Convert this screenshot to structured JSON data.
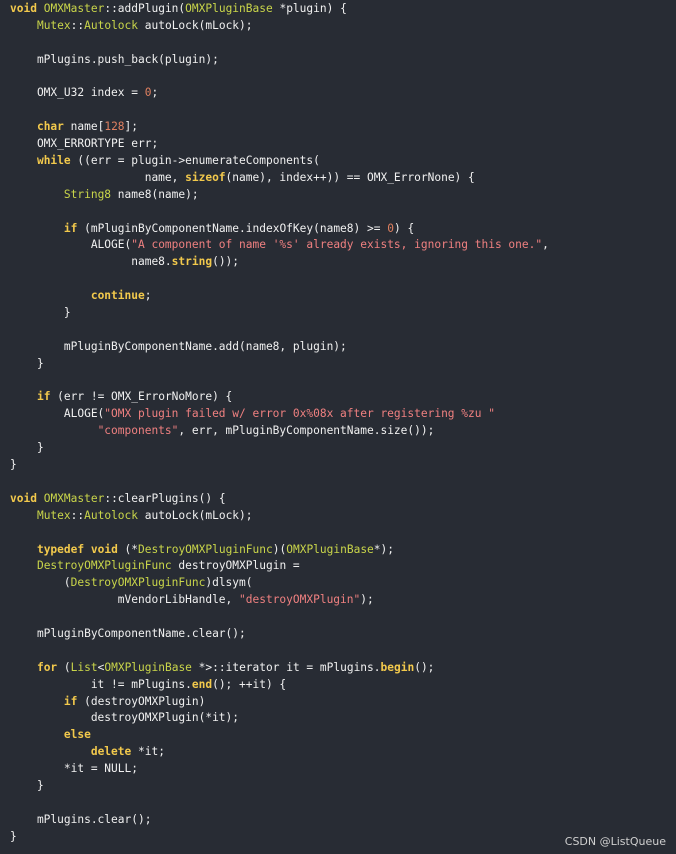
{
  "theme": {
    "background": "#282c34",
    "plain": "#f0f0f0",
    "keyword": "#f2c94c",
    "type": "#c9d54a",
    "string": "#ef8080",
    "number": "#e08060"
  },
  "code": {
    "lines": [
      [
        {
          "t": "kw",
          "v": "void"
        },
        {
          "t": "plain",
          "v": " "
        },
        {
          "t": "type",
          "v": "OMXMaster"
        },
        {
          "t": "plain",
          "v": "::addPlugin("
        },
        {
          "t": "type",
          "v": "OMXPluginBase"
        },
        {
          "t": "plain",
          "v": " *plugin) {"
        }
      ],
      [
        {
          "t": "plain",
          "v": "    "
        },
        {
          "t": "type",
          "v": "Mutex"
        },
        {
          "t": "plain",
          "v": "::"
        },
        {
          "t": "type",
          "v": "Autolock"
        },
        {
          "t": "plain",
          "v": " autoLock(mLock);"
        }
      ],
      [],
      [
        {
          "t": "plain",
          "v": "    mPlugins.push_back(plugin);"
        }
      ],
      [],
      [
        {
          "t": "plain",
          "v": "    OMX_U32 index = "
        },
        {
          "t": "num",
          "v": "0"
        },
        {
          "t": "plain",
          "v": ";"
        }
      ],
      [],
      [
        {
          "t": "plain",
          "v": "    "
        },
        {
          "t": "kw",
          "v": "char"
        },
        {
          "t": "plain",
          "v": " name["
        },
        {
          "t": "num",
          "v": "128"
        },
        {
          "t": "plain",
          "v": "];"
        }
      ],
      [
        {
          "t": "plain",
          "v": "    OMX_ERRORTYPE err;"
        }
      ],
      [
        {
          "t": "plain",
          "v": "    "
        },
        {
          "t": "kw",
          "v": "while"
        },
        {
          "t": "plain",
          "v": " ((err = plugin->enumerateComponents("
        }
      ],
      [
        {
          "t": "plain",
          "v": "                    name, "
        },
        {
          "t": "kw",
          "v": "sizeof"
        },
        {
          "t": "plain",
          "v": "(name), index++)) == OMX_ErrorNone) {"
        }
      ],
      [
        {
          "t": "plain",
          "v": "        "
        },
        {
          "t": "type",
          "v": "String8"
        },
        {
          "t": "plain",
          "v": " name8(name);"
        }
      ],
      [],
      [
        {
          "t": "plain",
          "v": "        "
        },
        {
          "t": "kw",
          "v": "if"
        },
        {
          "t": "plain",
          "v": " (mPluginByComponentName.indexOfKey(name8) >= "
        },
        {
          "t": "num",
          "v": "0"
        },
        {
          "t": "plain",
          "v": ") {"
        }
      ],
      [
        {
          "t": "plain",
          "v": "            ALOGE("
        },
        {
          "t": "str",
          "v": "\"A component of name '%s' already exists, ignoring this one.\""
        },
        {
          "t": "plain",
          "v": ","
        }
      ],
      [
        {
          "t": "plain",
          "v": "                  name8."
        },
        {
          "t": "kw",
          "v": "string"
        },
        {
          "t": "plain",
          "v": "());"
        }
      ],
      [],
      [
        {
          "t": "plain",
          "v": "            "
        },
        {
          "t": "kw",
          "v": "continue"
        },
        {
          "t": "plain",
          "v": ";"
        }
      ],
      [
        {
          "t": "plain",
          "v": "        }"
        }
      ],
      [],
      [
        {
          "t": "plain",
          "v": "        mPluginByComponentName.add(name8, plugin);"
        }
      ],
      [
        {
          "t": "plain",
          "v": "    }"
        }
      ],
      [],
      [
        {
          "t": "plain",
          "v": "    "
        },
        {
          "t": "kw",
          "v": "if"
        },
        {
          "t": "plain",
          "v": " (err != OMX_ErrorNoMore) {"
        }
      ],
      [
        {
          "t": "plain",
          "v": "        ALOGE("
        },
        {
          "t": "str",
          "v": "\"OMX plugin failed w/ error 0x%08x after registering %zu \""
        }
      ],
      [
        {
          "t": "plain",
          "v": "             "
        },
        {
          "t": "str",
          "v": "\"components\""
        },
        {
          "t": "plain",
          "v": ", err, mPluginByComponentName.size());"
        }
      ],
      [
        {
          "t": "plain",
          "v": "    }"
        }
      ],
      [
        {
          "t": "plain",
          "v": "}"
        }
      ],
      [],
      [
        {
          "t": "kw",
          "v": "void"
        },
        {
          "t": "plain",
          "v": " "
        },
        {
          "t": "type",
          "v": "OMXMaster"
        },
        {
          "t": "plain",
          "v": "::clearPlugins() {"
        }
      ],
      [
        {
          "t": "plain",
          "v": "    "
        },
        {
          "t": "type",
          "v": "Mutex"
        },
        {
          "t": "plain",
          "v": "::"
        },
        {
          "t": "type",
          "v": "Autolock"
        },
        {
          "t": "plain",
          "v": " autoLock(mLock);"
        }
      ],
      [],
      [
        {
          "t": "plain",
          "v": "    "
        },
        {
          "t": "kw",
          "v": "typedef"
        },
        {
          "t": "plain",
          "v": " "
        },
        {
          "t": "kw",
          "v": "void"
        },
        {
          "t": "plain",
          "v": " (*"
        },
        {
          "t": "type",
          "v": "DestroyOMXPluginFunc"
        },
        {
          "t": "plain",
          "v": ")("
        },
        {
          "t": "type",
          "v": "OMXPluginBase"
        },
        {
          "t": "plain",
          "v": "*);"
        }
      ],
      [
        {
          "t": "plain",
          "v": "    "
        },
        {
          "t": "type",
          "v": "DestroyOMXPluginFunc"
        },
        {
          "t": "plain",
          "v": " destroyOMXPlugin ="
        }
      ],
      [
        {
          "t": "plain",
          "v": "        ("
        },
        {
          "t": "type",
          "v": "DestroyOMXPluginFunc"
        },
        {
          "t": "plain",
          "v": ")dlsym("
        }
      ],
      [
        {
          "t": "plain",
          "v": "                mVendorLibHandle, "
        },
        {
          "t": "str",
          "v": "\"destroyOMXPlugin\""
        },
        {
          "t": "plain",
          "v": ");"
        }
      ],
      [],
      [
        {
          "t": "plain",
          "v": "    mPluginByComponentName.clear();"
        }
      ],
      [],
      [
        {
          "t": "plain",
          "v": "    "
        },
        {
          "t": "kw",
          "v": "for"
        },
        {
          "t": "plain",
          "v": " ("
        },
        {
          "t": "type",
          "v": "List"
        },
        {
          "t": "plain",
          "v": "<"
        },
        {
          "t": "type",
          "v": "OMXPluginBase"
        },
        {
          "t": "plain",
          "v": " *>::iterator it = mPlugins."
        },
        {
          "t": "kw",
          "v": "begin"
        },
        {
          "t": "plain",
          "v": "();"
        }
      ],
      [
        {
          "t": "plain",
          "v": "            it != mPlugins."
        },
        {
          "t": "kw",
          "v": "end"
        },
        {
          "t": "plain",
          "v": "(); ++it) {"
        }
      ],
      [
        {
          "t": "plain",
          "v": "        "
        },
        {
          "t": "kw",
          "v": "if"
        },
        {
          "t": "plain",
          "v": " (destroyOMXPlugin)"
        }
      ],
      [
        {
          "t": "plain",
          "v": "            destroyOMXPlugin(*it);"
        }
      ],
      [
        {
          "t": "plain",
          "v": "        "
        },
        {
          "t": "kw",
          "v": "else"
        }
      ],
      [
        {
          "t": "plain",
          "v": "            "
        },
        {
          "t": "kw",
          "v": "delete"
        },
        {
          "t": "plain",
          "v": " *it;"
        }
      ],
      [
        {
          "t": "plain",
          "v": "        *it = NULL;"
        }
      ],
      [
        {
          "t": "plain",
          "v": "    }"
        }
      ],
      [],
      [
        {
          "t": "plain",
          "v": "    mPlugins.clear();"
        }
      ],
      [
        {
          "t": "plain",
          "v": "}"
        }
      ]
    ]
  },
  "watermark": {
    "text": "CSDN @ListQueue"
  }
}
